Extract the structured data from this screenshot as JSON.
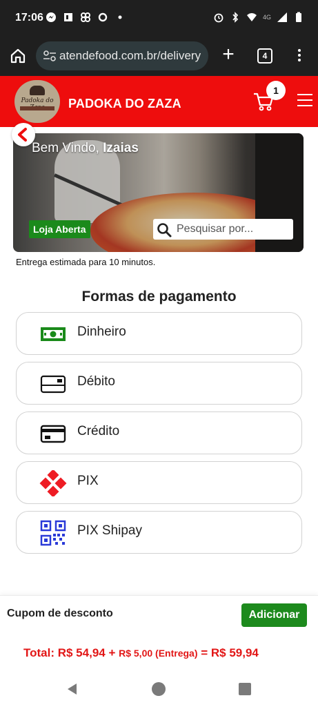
{
  "status_bar": {
    "time": "17:06",
    "network_label": "4G"
  },
  "browser": {
    "url": "atendefood.com.br/delivery",
    "tab_count": "4"
  },
  "header": {
    "logo_text": "Padoka do Zaza",
    "store_name": "PADOKA DO ZAZA",
    "cart_count": "1",
    "accent_color": "#ee0d0d"
  },
  "banner": {
    "welcome_prefix": "Bem Vindo, ",
    "user_name": "Izaias",
    "status_badge": "Loja Aberta",
    "search_placeholder": "Pesquisar por..."
  },
  "delivery_estimate": "Entrega estimada para 10 minutos.",
  "payment": {
    "title": "Formas de pagamento",
    "options": [
      {
        "label": "Dinheiro",
        "icon": "cash-icon"
      },
      {
        "label": "Débito",
        "icon": "debit-card-icon"
      },
      {
        "label": "Crédito",
        "icon": "credit-card-icon"
      },
      {
        "label": "PIX",
        "icon": "pix-icon"
      },
      {
        "label": "PIX Shipay",
        "icon": "qr-code-icon"
      }
    ]
  },
  "footer": {
    "coupon_label": "Cupom de desconto",
    "add_button": "Adicionar",
    "total_prefix": "Total: R$ 54,94 + ",
    "delivery_part": "R$ 5,00 (Entrega)",
    "total_suffix": " = R$ 59,94"
  }
}
